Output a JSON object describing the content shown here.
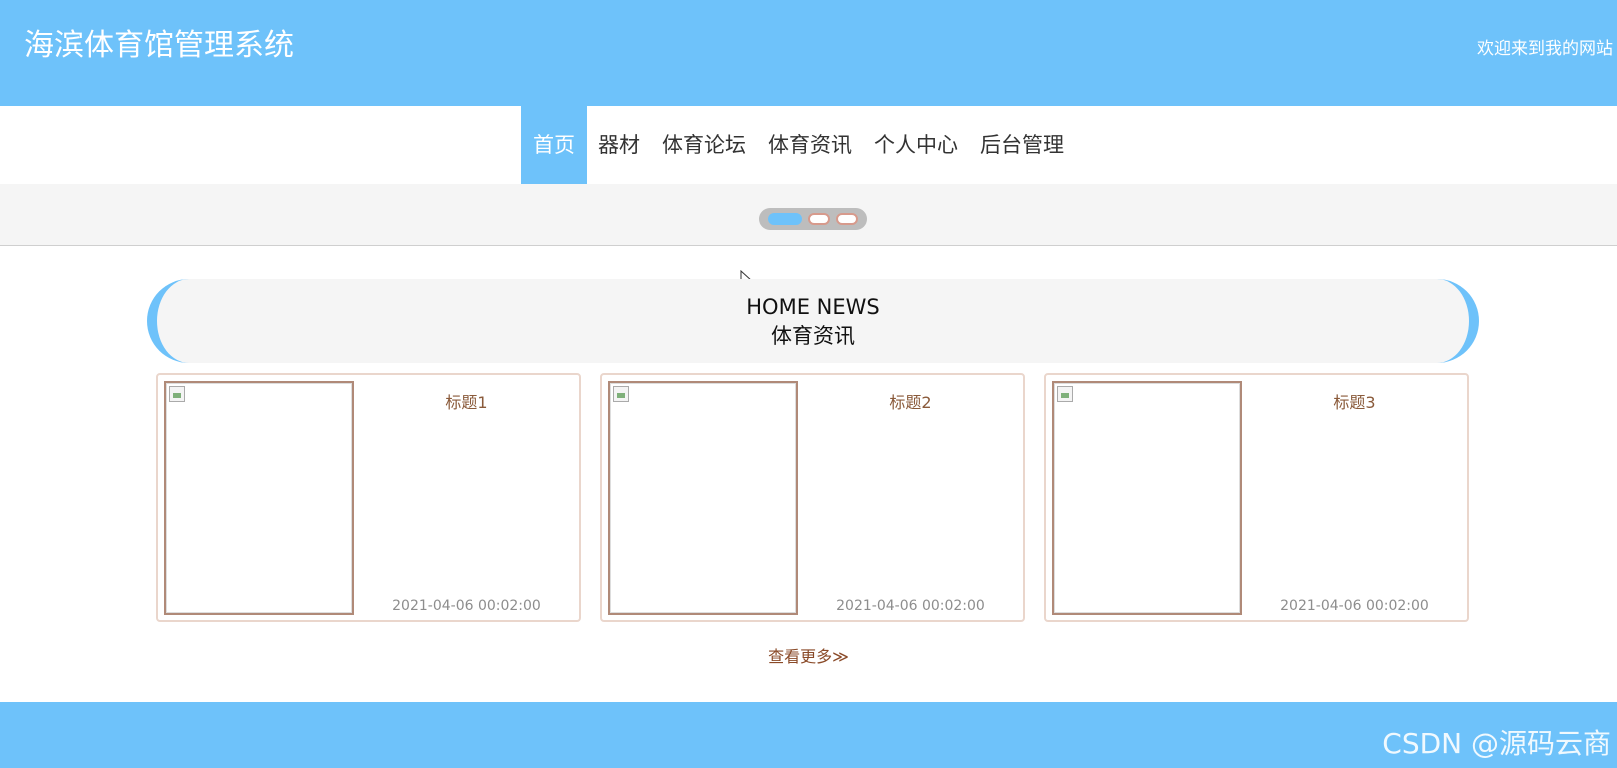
{
  "header": {
    "title": "海滨体育馆管理系统",
    "welcome": "欢迎来到我的网站"
  },
  "nav": {
    "items": [
      {
        "label": "首页",
        "active": true
      },
      {
        "label": "器材",
        "active": false
      },
      {
        "label": "体育论坛",
        "active": false
      },
      {
        "label": "体育资讯",
        "active": false
      },
      {
        "label": "个人中心",
        "active": false
      },
      {
        "label": "后台管理",
        "active": false
      }
    ]
  },
  "banner": {
    "slides": 3,
    "active_slide": 1
  },
  "news": {
    "en_title": "HOME NEWS",
    "cn_title": "体育资讯",
    "items": [
      {
        "title": "标题1",
        "date": "2021-04-06 00:02:00"
      },
      {
        "title": "标题2",
        "date": "2021-04-06 00:02:00"
      },
      {
        "title": "标题3",
        "date": "2021-04-06 00:02:00"
      }
    ],
    "more": "查看更多≫"
  },
  "footer": {
    "watermark": "CSDN @源码云商"
  },
  "colors": {
    "primary": "#6ec2fa",
    "card_border": "#ead6cc",
    "title_text": "#8a5a3a"
  }
}
